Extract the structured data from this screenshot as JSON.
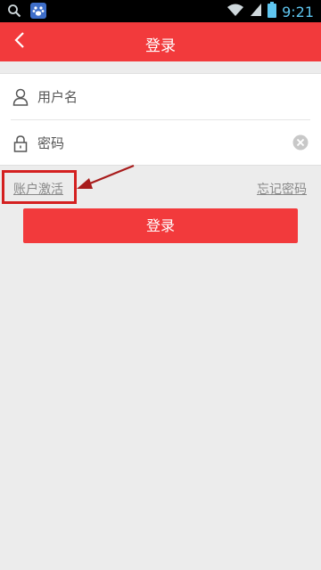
{
  "status_bar": {
    "time": "9:21",
    "icons": [
      "search-icon",
      "baidu-paw-icon",
      "wifi-icon",
      "signal-icon",
      "battery-icon"
    ],
    "accent_color": "#5fc6f0"
  },
  "header": {
    "title": "登录",
    "back_icon": "chevron-left-icon",
    "background_color": "#f23a3c"
  },
  "form": {
    "username": {
      "icon": "user-icon",
      "placeholder": "用户名",
      "value": ""
    },
    "password": {
      "icon": "lock-icon",
      "placeholder": "密码",
      "value": "",
      "clear_icon": "clear-icon"
    }
  },
  "links": {
    "activate_account": "账户激活",
    "forgot_password": "忘记密码"
  },
  "actions": {
    "login_label": "登录"
  },
  "annotation": {
    "highlight_color": "#d42020"
  }
}
